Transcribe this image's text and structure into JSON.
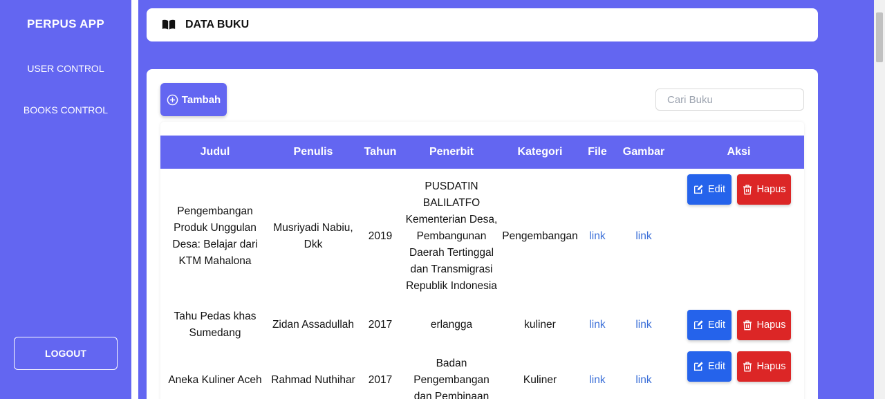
{
  "sidebar": {
    "brand": "PERPUS APP",
    "items": [
      {
        "label": "USER CONTROL"
      },
      {
        "label": "BOOKS CONTROL"
      }
    ],
    "logout_label": "LOGOUT"
  },
  "header": {
    "title": "DATA BUKU",
    "icon": "book-open-icon"
  },
  "toolbar": {
    "add_label": "Tambah",
    "search_placeholder": "Cari Buku"
  },
  "table": {
    "columns": [
      "Judul",
      "Penulis",
      "Tahun",
      "Penerbit",
      "Kategori",
      "File",
      "Gambar",
      "Aksi"
    ],
    "rows": [
      {
        "judul": "Pengembangan Produk Unggulan Desa: Belajar dari KTM Mahalona",
        "penulis": "Musriyadi Nabiu, Dkk",
        "tahun": "2019",
        "penerbit": "PUSDATIN BALILATFO Kementerian Desa, Pembangunan Daerah Tertinggal dan Transmigrasi Republik Indonesia",
        "kategori": "Pengembangan",
        "file": "link",
        "gambar": "link",
        "edit": "Edit",
        "hapus": "Hapus"
      },
      {
        "judul": "Tahu Pedas khas Sumedang",
        "penulis": "Zidan Assadullah",
        "tahun": "2017",
        "penerbit": "erlangga",
        "kategori": "kuliner",
        "file": "link",
        "gambar": "link",
        "edit": "Edit",
        "hapus": "Hapus"
      },
      {
        "judul": "Aneka Kuliner Aceh",
        "penulis": "Rahmad Nuthihar",
        "tahun": "2017",
        "penerbit": "Badan Pengembangan dan Pembinaan",
        "kategori": "Kuliner",
        "file": "link",
        "gambar": "link",
        "edit": "Edit",
        "hapus": "Hapus"
      }
    ]
  },
  "colors": {
    "primary": "#6366f1",
    "edit": "#2563eb",
    "delete": "#dc2626",
    "link": "#3b6fd8"
  }
}
